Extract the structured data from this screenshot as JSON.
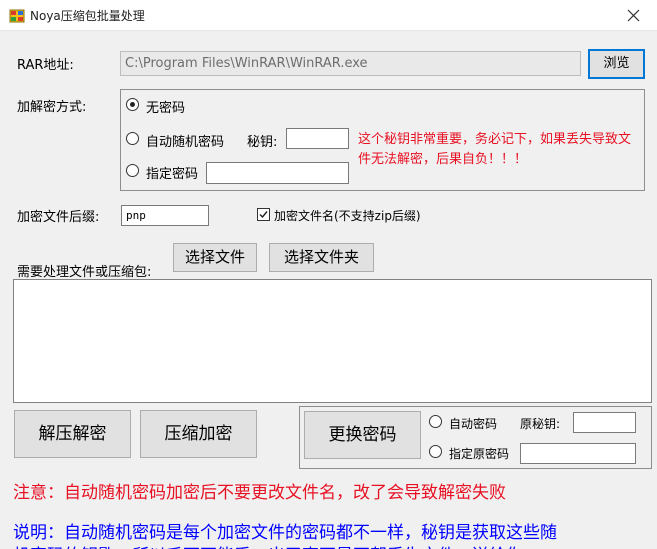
{
  "window": {
    "title": "Noya压缩包批量处理",
    "icon": "app-icon",
    "close_icon": "close-icon"
  },
  "rar": {
    "label": "RAR地址:",
    "path": "C:\\Program Files\\WinRAR\\WinRAR.exe",
    "browse_label": "浏览"
  },
  "mode": {
    "label": "加解密方式:",
    "no_password": "无密码",
    "auto_random": "自动随机密码",
    "key_label": "秘钥:",
    "key_value": "",
    "specified": "指定密码",
    "specified_value": "",
    "warning": "这个秘钥非常重要，务必记下，如果丢失导致文件无法解密，后果自负！！！",
    "selected": "no_password"
  },
  "suffix": {
    "label": "加密文件后缀:",
    "value": "pnp",
    "encrypt_name_label": "加密文件名(不支持zip后缀)",
    "encrypt_name_checked": true
  },
  "files": {
    "label": "需要处理文件或压缩包:",
    "select_file_label": "选择文件",
    "select_folder_label": "选择文件夹",
    "items": []
  },
  "actions": {
    "decompress_label": "解压解密",
    "compress_label": "压缩加密",
    "change_password_label": "更换密码",
    "auto_password_label": "自动密码",
    "original_key_label": "原秘钥:",
    "original_key_value": "",
    "specified_original_label": "指定原密码",
    "specified_original_value": ""
  },
  "notes": {
    "notice": "注意：自动随机密码加密后不要更改文件名，改了会导致解密失败",
    "description_line1": "说明：自动随机密码是每个加密文件的密码都不一样，秘钥是获取这些随",
    "description_line2": "机密码的钥匙，所以千万不能丢，出了事不是不帮丢失文件，送给你"
  },
  "colors": {
    "warning_red": "#e81123",
    "note_blue": "#0000ff",
    "accent": "#0078d7",
    "background": "#f0f0f0"
  }
}
